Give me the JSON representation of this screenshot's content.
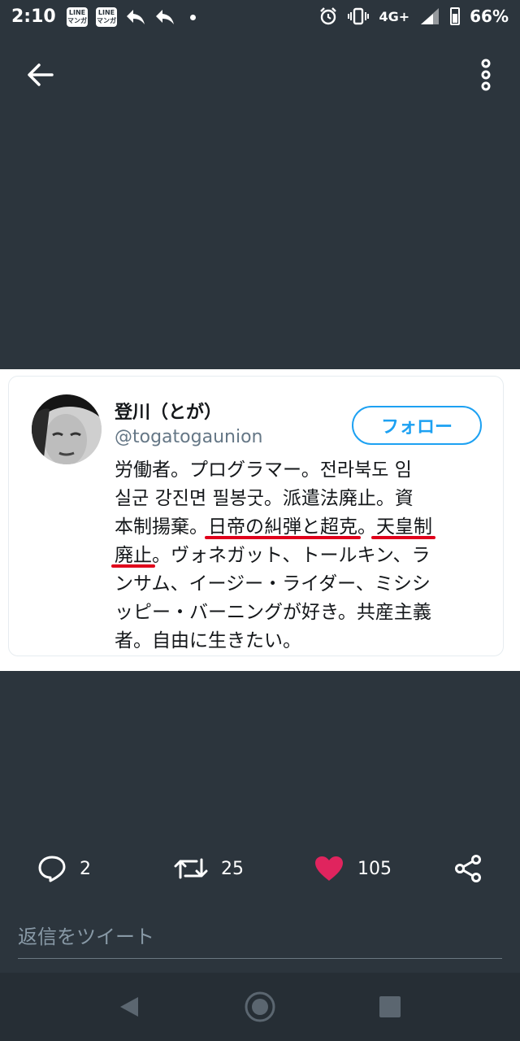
{
  "status_bar": {
    "time": "2:10",
    "line_badge_text": "LINE\nマンガ",
    "network": "4G+",
    "battery": "66%"
  },
  "topbar": {
    "back_icon": "arrow-left-icon",
    "more_icon": "more-vertical-icon"
  },
  "profile_card": {
    "name": "登川（とが）",
    "handle": "@togatogaunion",
    "follow_label": "フォロー",
    "bio_lines": [
      "労働者。プログラマー。전라북도 임",
      "실군 강진면 필봉굿。派遣法廃止。資",
      [
        "本制揚棄。",
        "日帝の糾弾と超克",
        "。",
        "天皇制"
      ],
      [
        "廃止",
        "。ヴォネガット、トールキン、ラ"
      ],
      "ンサム、イージー・ライダー、ミシシ",
      "ッピー・バーニングが好き。共産主義",
      "者。自由に生きたい。"
    ]
  },
  "actions": {
    "reply_count": "2",
    "retweet_count": "25",
    "like_count": "105"
  },
  "reply": {
    "placeholder": "返信をツイート"
  },
  "colors": {
    "background": "#2c353d",
    "accent": "#1da1f2",
    "like": "#e0245e",
    "highlight": "#e0001b"
  }
}
